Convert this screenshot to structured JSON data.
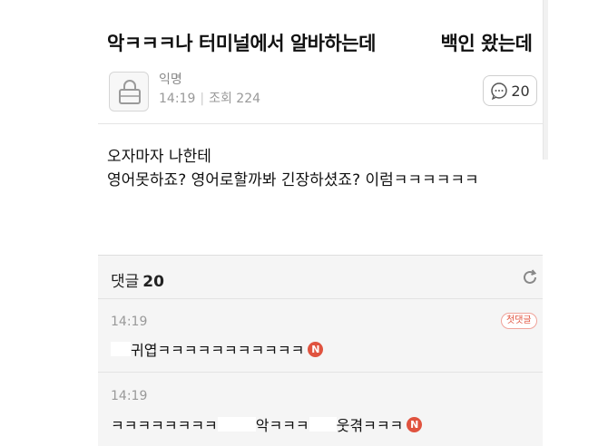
{
  "post": {
    "title_part1": "악ㅋㅋㅋ나 터미널에서 알바하는데",
    "title_part2": "백인 왔는데",
    "author": "익명",
    "time": "14:19",
    "views_label": "조회",
    "views": "224",
    "comment_count": "20",
    "body": "오자마자 나한테\n영어못하죠? 영어로할까봐 긴장하셨죠? 이럼ㅋㅋㅋㅋㅋㅋ"
  },
  "comments_section": {
    "label": "댓글",
    "count": "20"
  },
  "comments": [
    {
      "time": "14:19",
      "text": "귀엽ㅋㅋㅋㅋㅋㅋㅋㅋㅋㅋㅋ",
      "badge": "첫댓글",
      "new_mark": "N"
    },
    {
      "time": "14:19",
      "text_a": "ㅋㅋㅋㅋㅋㅋㅋㅋ",
      "text_b": "악ㅋㅋㅋ",
      "text_c": "웃겪ㅋㅋㅋ",
      "new_mark": "N"
    }
  ],
  "colors": {
    "accent": "#e0533f",
    "muted": "#999999",
    "background": "#f5f5f5"
  },
  "icons": [
    "lock-avatar-icon",
    "comment-bubble-icon",
    "refresh-icon"
  ]
}
